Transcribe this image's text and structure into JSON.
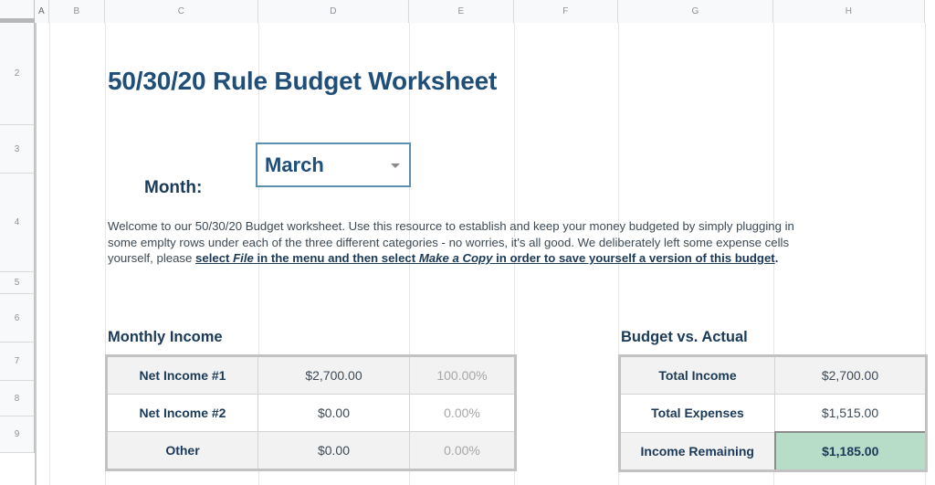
{
  "grid": {
    "columns": [
      "A",
      "B",
      "C",
      "D",
      "E",
      "F",
      "G",
      "H"
    ],
    "rows": [
      "2",
      "3",
      "4",
      "5",
      "6",
      "7",
      "8",
      "9"
    ],
    "active_column": "A"
  },
  "header": {
    "title": "50/30/20 Rule Budget Worksheet"
  },
  "month_selector": {
    "label": "Month:",
    "value": "March",
    "arrow_icon": "chevron-down-icon"
  },
  "intro": {
    "line1_a": "Welcome to our 50/30/20 Budget worksheet. Use this resource to establish and keep your money budgeted by simply plugging in",
    "line2_a": "some emplty rows under each of the three different categories - no worries, it's all good. We deliberately left some expense cells",
    "line3_a": "yourself, please ",
    "line3_b": "select ",
    "line3_c": "File",
    "line3_d": " in the menu and then select ",
    "line3_e": "Make a Copy",
    "line3_f": " in order to save yourself a version of this budget",
    "line3_g": "."
  },
  "income_section": {
    "title": "Monthly Income",
    "rows": [
      {
        "label": "Net Income #1",
        "amount": "$2,700.00",
        "percent": "100.00%"
      },
      {
        "label": "Net Income #2",
        "amount": "$0.00",
        "percent": "0.00%"
      },
      {
        "label": "Other",
        "amount": "$0.00",
        "percent": "0.00%"
      }
    ]
  },
  "budget_section": {
    "title": "Budget vs. Actual",
    "rows": [
      {
        "label": "Total Income",
        "amount": "$2,700.00"
      },
      {
        "label": "Total Expenses",
        "amount": "$1,515.00"
      },
      {
        "label": "Income Remaining",
        "amount": "$1,185.00"
      }
    ]
  },
  "colors": {
    "title_navy": "#1f4e79",
    "dropdown_border": "#5b8faf",
    "highlight_green": "#b7ddc8",
    "percent_gray": "#a6a6a6"
  }
}
